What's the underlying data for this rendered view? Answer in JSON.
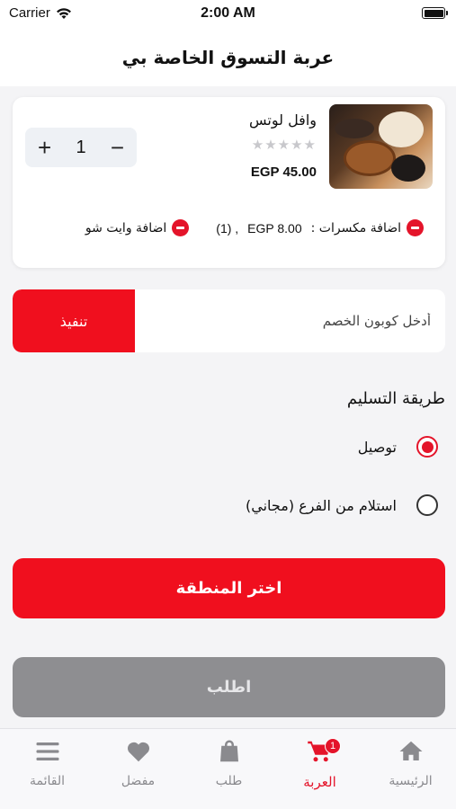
{
  "status_bar": {
    "carrier": "Carrier",
    "time": "2:00 AM"
  },
  "header": {
    "title": "عربة التسوق الخاصة بي"
  },
  "cart_item": {
    "name": "وافل لوتس",
    "rating": 0,
    "rating_max": 5,
    "price": "EGP 45.00",
    "quantity": "1",
    "plus_label": "+",
    "minus_label": "−",
    "addons": [
      {
        "label": "اضافة مكسرات :",
        "price": "EGP 8.00",
        "count": "(1) ,"
      },
      {
        "label": "اضافة وايت شو"
      }
    ]
  },
  "coupon": {
    "placeholder": "أدخل كوبون الخصم",
    "apply_label": "تنفيذ"
  },
  "delivery": {
    "title": "طريقة التسليم",
    "options": [
      {
        "label": "توصيل",
        "selected": true
      },
      {
        "label": "استلام من الفرع  (مجاني)",
        "selected": false
      }
    ]
  },
  "buttons": {
    "choose_region": "اختر المنطقة",
    "order": "اطلب"
  },
  "tab_bar": {
    "tabs": [
      {
        "label": "الرئيسية",
        "icon": "home-icon"
      },
      {
        "label": "العربة",
        "icon": "cart-icon",
        "active": true,
        "badge": "1"
      },
      {
        "label": "طلب",
        "icon": "bag-icon"
      },
      {
        "label": "مفضل",
        "icon": "heart-icon"
      },
      {
        "label": "القائمة",
        "icon": "menu-icon"
      }
    ]
  },
  "colors": {
    "accent": "#f00f1e",
    "disabled": "#8e8e91",
    "background": "#f4f4f6"
  }
}
